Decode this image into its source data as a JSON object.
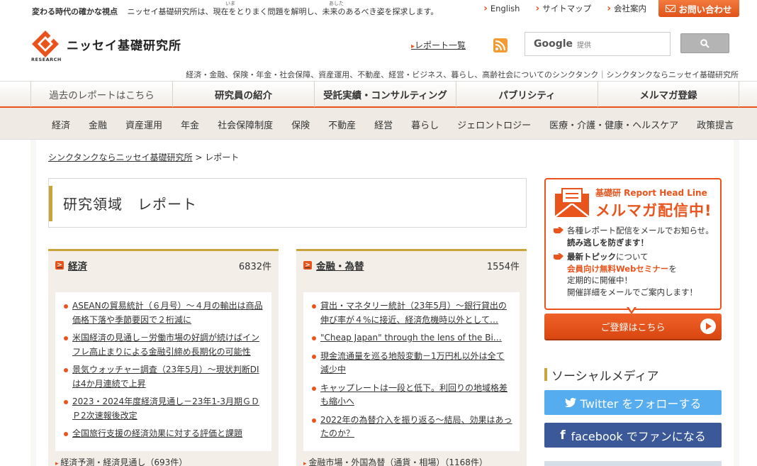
{
  "topbar": {
    "tagline_bold": "変わる時代の確かな視点",
    "tagline": "ニッセイ基礎研究所は、現在をとりまく問題を解明し、未来のあるべき姿を探求します。",
    "ruby_ima": "いま",
    "ruby_ashita": "あした",
    "links": [
      "English",
      "サイトマップ",
      "会社案内"
    ],
    "contact_label": "お問い合わせ"
  },
  "header": {
    "site_name": "ニッセイ基礎研究所",
    "logo_sub": "RESEARCH",
    "report_list_link": "レポート一覧",
    "search_brand": "Google",
    "search_brand_suffix": "提供",
    "description": "経済・金融、保険・年金・社会保障、資産運用、不動産、経営・ビジネス、暮らし、高齢社会についてのシンクタンク｜シンクタンクならニッセイ基礎研究所"
  },
  "mainnav": [
    "過去のレポートはこちら",
    "研究員の紹介",
    "受託実績・コンサルティング",
    "パブリシティ",
    "メルマガ登録"
  ],
  "subnav": [
    "経済",
    "金融",
    "資産運用",
    "年金",
    "社会保障制度",
    "保険",
    "不動産",
    "経営",
    "暮らし",
    "ジェロントロジー",
    "医療・介護・健康・ヘルスケア",
    "政策提言"
  ],
  "breadcrumb": {
    "home": "シンクタンクならニッセイ基礎研究所",
    "sep": " > ",
    "current": "レポート"
  },
  "page_title": "研究領域　レポート",
  "panels": [
    {
      "title": "経済",
      "count": "6832件",
      "items": [
        "ASEANの貿易統計（６月号）～４月の輸出は商品価格下落や季節要因で２桁減に",
        "米国経済の見通し－労働市場の好調が続けばインフレ高止まりによる金融引締め長期化の可能性",
        "景気ウォッチャー調査（23年5月）～現状判断DIは4か月連続で上昇",
        "2023・2024年度経済見通し－23年1-3月期ＧＤＰ2次速報後改定",
        "全国旅行支援の経済効果に対する評価と課題"
      ],
      "sub": "経済予測・経済見通し（693件）"
    },
    {
      "title": "金融・為替",
      "count": "1554件",
      "items": [
        "貸出・マネタリー統計（23年5月）～銀行貸出の伸び率が４%に接近、経済危機時以外として…",
        "\"Cheap Japan\" through the lens of the Bi…",
        "現金流通量を巡る地殻変動－1万円札以外は全て減少中",
        "キャップレートは一段と低下。利回りの地域格差も縮小へ",
        "2022年の為替介入を振り返る～結局、効果はあったのか？"
      ],
      "sub": "金融市場・外国為替（通貨・相場）（1168件）"
    }
  ],
  "sidebar": {
    "mm_kicker": "基礎研 Report Head Line",
    "mm_headline": "メルマガ配信中!",
    "b1_text": "各種レポート配信をメールでお知らせ。",
    "b1_bold": "読み逃しを防ぎます！",
    "b2_bold": "最新トピック",
    "b2_text": "について",
    "b2_red": "会員向け無料Webセミナー",
    "b2_text2": "を",
    "b2_text3": "定期的に開催中！",
    "b2_text4": "開催詳細をメールでご案内します！",
    "mm_button": "ご登録はこちら",
    "social_head": "ソーシャルメディア",
    "twitter_label": "Twitter をフォローする",
    "facebook_label": "facebook でファンになる"
  },
  "colors": {
    "accent": "#e9541c",
    "gold": "#c8a43a",
    "twitter": "#55acee",
    "facebook": "#3b5998"
  }
}
